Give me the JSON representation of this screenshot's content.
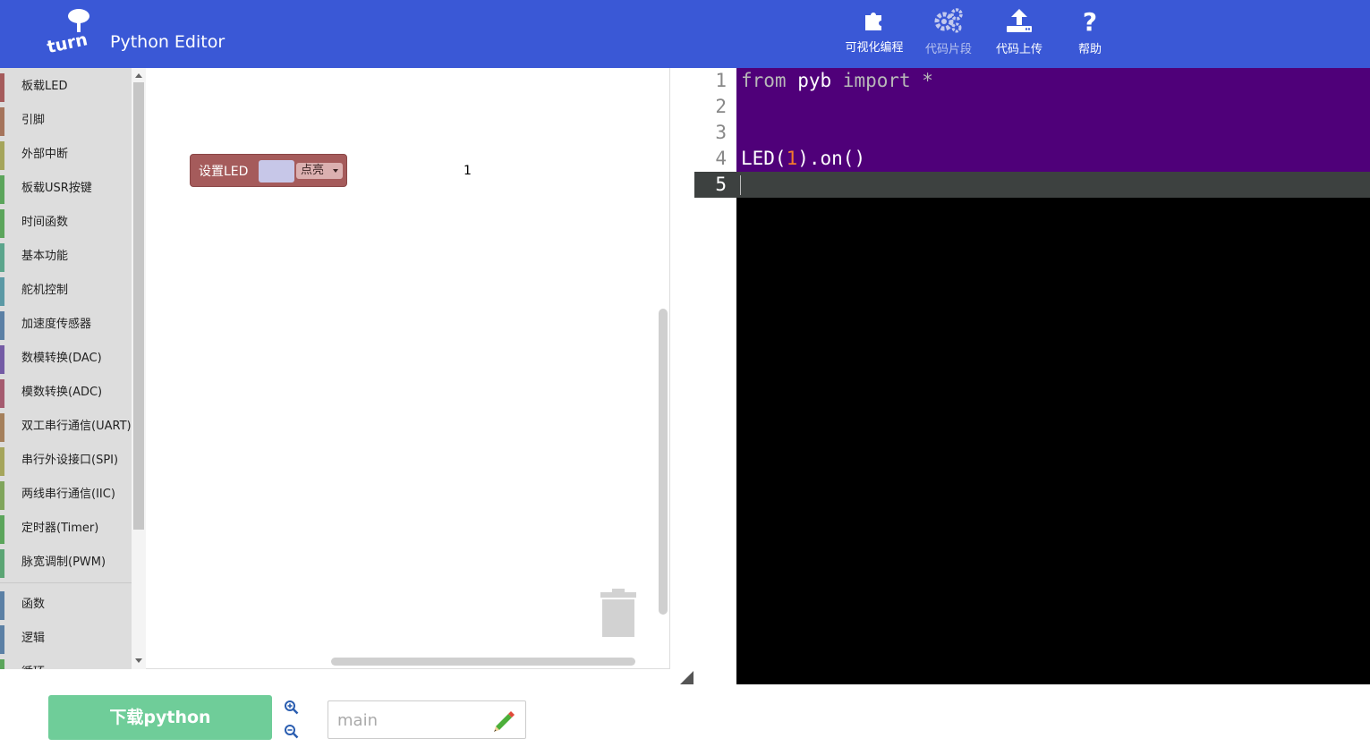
{
  "header": {
    "app_title": "Python Editor",
    "nav": [
      {
        "label": "可视化编程",
        "icon": "puzzle-icon",
        "enabled": true
      },
      {
        "label": "代码片段",
        "icon": "gears-icon",
        "enabled": false
      },
      {
        "label": "代码上传",
        "icon": "upload-icon",
        "enabled": true
      },
      {
        "label": "帮助",
        "icon": "question-icon",
        "enabled": true
      }
    ],
    "brand_color": "#3a58d6"
  },
  "toolbox": {
    "items": [
      {
        "label": "板载LED",
        "color": "#a55b5b"
      },
      {
        "label": "引脚",
        "color": "#a5745b"
      },
      {
        "label": "外部中断",
        "color": "#a5a55b"
      },
      {
        "label": "板载USR按键",
        "color": "#5ba55b"
      },
      {
        "label": "时间函数",
        "color": "#5ba55b"
      },
      {
        "label": "基本功能",
        "color": "#5ba58c"
      },
      {
        "label": "舵机控制",
        "color": "#5b99a5"
      },
      {
        "label": "加速度传感器",
        "color": "#5b80a5"
      },
      {
        "label": "数模转换(DAC)",
        "color": "#745ba5"
      },
      {
        "label": "模数转换(ADC)",
        "color": "#a55b6f"
      },
      {
        "label": "双工串行通信(UART)",
        "color": "#a5805b"
      },
      {
        "label": "串行外设接口(SPI)",
        "color": "#a5a55b"
      },
      {
        "label": "两线串行通信(IIC)",
        "color": "#80a55b"
      },
      {
        "label": "定时器(Timer)",
        "color": "#5ba55b"
      },
      {
        "label": "脉宽调制(PWM)",
        "color": "#5ba574"
      }
    ],
    "items2": [
      {
        "label": "函数",
        "color": "#5b80a5"
      },
      {
        "label": "逻辑",
        "color": "#5b80a5"
      },
      {
        "label": "循环",
        "color": "#5ba55b"
      }
    ]
  },
  "workspace": {
    "block": {
      "label": "设置LED",
      "number": "1",
      "dropdown": "点亮",
      "color": "#a55b5b"
    }
  },
  "editor": {
    "line_numbers": [
      "1",
      "2",
      "3",
      "4",
      "5"
    ],
    "lines": [
      {
        "kw1": "from",
        "mid": " pyb ",
        "kw2": "import",
        "rest": " *"
      },
      {
        "text": ""
      },
      {
        "text": ""
      },
      {
        "pre": "LED(",
        "num": "1",
        "post": ").on()"
      },
      {
        "text": ""
      }
    ]
  },
  "footer": {
    "download_label": "下载python",
    "filename_placeholder": "main",
    "download_color": "#6fcd99"
  }
}
